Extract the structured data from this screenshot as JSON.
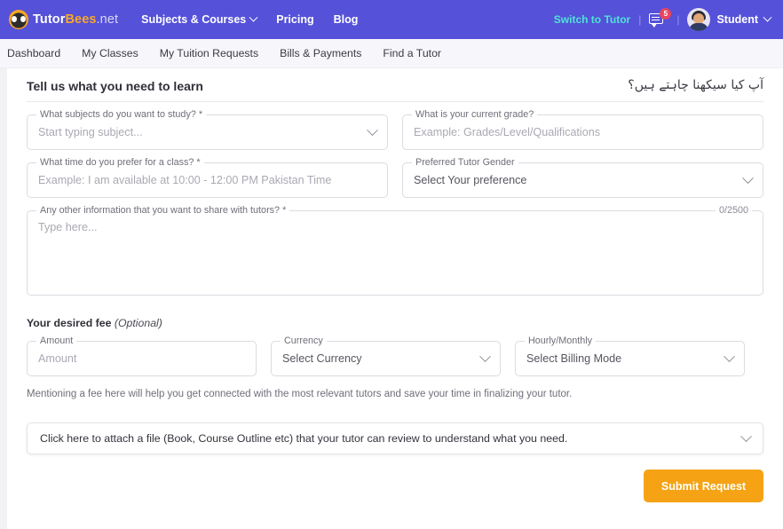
{
  "header": {
    "brand": {
      "part1": "Tutor",
      "part2": "Bees",
      "part3": ".net"
    },
    "nav": [
      {
        "label": "Subjects & Courses",
        "has_caret": true
      },
      {
        "label": "Pricing",
        "has_caret": false
      },
      {
        "label": "Blog",
        "has_caret": false
      }
    ],
    "switch_role_label": "Switch to Tutor",
    "separator": "|",
    "messages_badge": "5",
    "user_name": "Student",
    "colors": {
      "bar": "#5551d9",
      "switch_link": "#4fe3d7",
      "badge": "#e8455f",
      "brand_accent": "#f9a826"
    }
  },
  "subnav": {
    "items": [
      {
        "label": "Dashboard"
      },
      {
        "label": "My Classes"
      },
      {
        "label": "My Tuition Requests"
      },
      {
        "label": "Bills & Payments"
      },
      {
        "label": "Find a Tutor"
      }
    ]
  },
  "main": {
    "title": "Tell us what you need to learn",
    "title_urdu": "آپ کیا سیکھنا چاہتے ہیں؟",
    "fields": {
      "subjects": {
        "label": "What subjects do you want to study? *",
        "placeholder": "Start typing subject..."
      },
      "grade": {
        "label": "What is your current grade?",
        "placeholder": "Example: Grades/Level/Qualifications"
      },
      "time": {
        "label": "What time do you prefer for a class? *",
        "placeholder": "Example: I am available at 10:00 - 12:00 PM Pakistan Time"
      },
      "gender": {
        "label": "Preferred Tutor Gender",
        "value": "Select Your preference"
      },
      "other_info": {
        "label": "Any other information that you want to share with tutors? *",
        "placeholder": "Type here...",
        "counter": "0/2500"
      }
    },
    "fee": {
      "heading": "Your desired fee",
      "heading_optional": "(Optional)",
      "amount": {
        "label": "Amount",
        "placeholder": "Amount"
      },
      "currency": {
        "label": "Currency",
        "value": "Select Currency"
      },
      "billing": {
        "label": "Hourly/Monthly",
        "value": "Select Billing Mode"
      },
      "note": "Mentioning a fee here will help you get connected with the most relevant tutors and save your time in finalizing your tutor."
    },
    "attachment": {
      "label": "Click here to attach a file (Book, Course Outline etc) that your tutor can review to understand what you need."
    },
    "submit_label": "Submit Request",
    "submit_color": "#f5a314"
  }
}
